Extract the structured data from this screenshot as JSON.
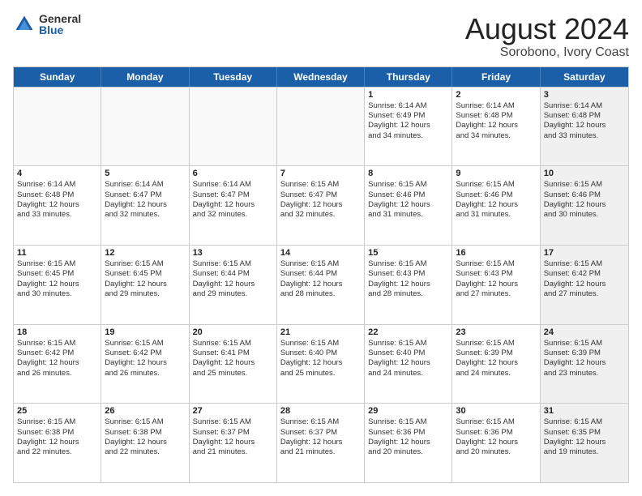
{
  "logo": {
    "general": "General",
    "blue": "Blue"
  },
  "title": "August 2024",
  "location": "Sorobono, Ivory Coast",
  "days": [
    "Sunday",
    "Monday",
    "Tuesday",
    "Wednesday",
    "Thursday",
    "Friday",
    "Saturday"
  ],
  "weeks": [
    [
      {
        "day": "",
        "empty": true
      },
      {
        "day": "",
        "empty": true
      },
      {
        "day": "",
        "empty": true
      },
      {
        "day": "",
        "empty": true
      },
      {
        "day": "1",
        "lines": [
          "Sunrise: 6:14 AM",
          "Sunset: 6:49 PM",
          "Daylight: 12 hours",
          "and 34 minutes."
        ]
      },
      {
        "day": "2",
        "lines": [
          "Sunrise: 6:14 AM",
          "Sunset: 6:48 PM",
          "Daylight: 12 hours",
          "and 34 minutes."
        ]
      },
      {
        "day": "3",
        "shaded": true,
        "lines": [
          "Sunrise: 6:14 AM",
          "Sunset: 6:48 PM",
          "Daylight: 12 hours",
          "and 33 minutes."
        ]
      }
    ],
    [
      {
        "day": "4",
        "lines": [
          "Sunrise: 6:14 AM",
          "Sunset: 6:48 PM",
          "Daylight: 12 hours",
          "and 33 minutes."
        ]
      },
      {
        "day": "5",
        "lines": [
          "Sunrise: 6:14 AM",
          "Sunset: 6:47 PM",
          "Daylight: 12 hours",
          "and 32 minutes."
        ]
      },
      {
        "day": "6",
        "lines": [
          "Sunrise: 6:14 AM",
          "Sunset: 6:47 PM",
          "Daylight: 12 hours",
          "and 32 minutes."
        ]
      },
      {
        "day": "7",
        "lines": [
          "Sunrise: 6:15 AM",
          "Sunset: 6:47 PM",
          "Daylight: 12 hours",
          "and 32 minutes."
        ]
      },
      {
        "day": "8",
        "lines": [
          "Sunrise: 6:15 AM",
          "Sunset: 6:46 PM",
          "Daylight: 12 hours",
          "and 31 minutes."
        ]
      },
      {
        "day": "9",
        "lines": [
          "Sunrise: 6:15 AM",
          "Sunset: 6:46 PM",
          "Daylight: 12 hours",
          "and 31 minutes."
        ]
      },
      {
        "day": "10",
        "shaded": true,
        "lines": [
          "Sunrise: 6:15 AM",
          "Sunset: 6:46 PM",
          "Daylight: 12 hours",
          "and 30 minutes."
        ]
      }
    ],
    [
      {
        "day": "11",
        "lines": [
          "Sunrise: 6:15 AM",
          "Sunset: 6:45 PM",
          "Daylight: 12 hours",
          "and 30 minutes."
        ]
      },
      {
        "day": "12",
        "lines": [
          "Sunrise: 6:15 AM",
          "Sunset: 6:45 PM",
          "Daylight: 12 hours",
          "and 29 minutes."
        ]
      },
      {
        "day": "13",
        "lines": [
          "Sunrise: 6:15 AM",
          "Sunset: 6:44 PM",
          "Daylight: 12 hours",
          "and 29 minutes."
        ]
      },
      {
        "day": "14",
        "lines": [
          "Sunrise: 6:15 AM",
          "Sunset: 6:44 PM",
          "Daylight: 12 hours",
          "and 28 minutes."
        ]
      },
      {
        "day": "15",
        "lines": [
          "Sunrise: 6:15 AM",
          "Sunset: 6:43 PM",
          "Daylight: 12 hours",
          "and 28 minutes."
        ]
      },
      {
        "day": "16",
        "lines": [
          "Sunrise: 6:15 AM",
          "Sunset: 6:43 PM",
          "Daylight: 12 hours",
          "and 27 minutes."
        ]
      },
      {
        "day": "17",
        "shaded": true,
        "lines": [
          "Sunrise: 6:15 AM",
          "Sunset: 6:42 PM",
          "Daylight: 12 hours",
          "and 27 minutes."
        ]
      }
    ],
    [
      {
        "day": "18",
        "lines": [
          "Sunrise: 6:15 AM",
          "Sunset: 6:42 PM",
          "Daylight: 12 hours",
          "and 26 minutes."
        ]
      },
      {
        "day": "19",
        "lines": [
          "Sunrise: 6:15 AM",
          "Sunset: 6:42 PM",
          "Daylight: 12 hours",
          "and 26 minutes."
        ]
      },
      {
        "day": "20",
        "lines": [
          "Sunrise: 6:15 AM",
          "Sunset: 6:41 PM",
          "Daylight: 12 hours",
          "and 25 minutes."
        ]
      },
      {
        "day": "21",
        "lines": [
          "Sunrise: 6:15 AM",
          "Sunset: 6:40 PM",
          "Daylight: 12 hours",
          "and 25 minutes."
        ]
      },
      {
        "day": "22",
        "lines": [
          "Sunrise: 6:15 AM",
          "Sunset: 6:40 PM",
          "Daylight: 12 hours",
          "and 24 minutes."
        ]
      },
      {
        "day": "23",
        "lines": [
          "Sunrise: 6:15 AM",
          "Sunset: 6:39 PM",
          "Daylight: 12 hours",
          "and 24 minutes."
        ]
      },
      {
        "day": "24",
        "shaded": true,
        "lines": [
          "Sunrise: 6:15 AM",
          "Sunset: 6:39 PM",
          "Daylight: 12 hours",
          "and 23 minutes."
        ]
      }
    ],
    [
      {
        "day": "25",
        "lines": [
          "Sunrise: 6:15 AM",
          "Sunset: 6:38 PM",
          "Daylight: 12 hours",
          "and 22 minutes."
        ]
      },
      {
        "day": "26",
        "lines": [
          "Sunrise: 6:15 AM",
          "Sunset: 6:38 PM",
          "Daylight: 12 hours",
          "and 22 minutes."
        ]
      },
      {
        "day": "27",
        "lines": [
          "Sunrise: 6:15 AM",
          "Sunset: 6:37 PM",
          "Daylight: 12 hours",
          "and 21 minutes."
        ]
      },
      {
        "day": "28",
        "lines": [
          "Sunrise: 6:15 AM",
          "Sunset: 6:37 PM",
          "Daylight: 12 hours",
          "and 21 minutes."
        ]
      },
      {
        "day": "29",
        "lines": [
          "Sunrise: 6:15 AM",
          "Sunset: 6:36 PM",
          "Daylight: 12 hours",
          "and 20 minutes."
        ]
      },
      {
        "day": "30",
        "lines": [
          "Sunrise: 6:15 AM",
          "Sunset: 6:36 PM",
          "Daylight: 12 hours",
          "and 20 minutes."
        ]
      },
      {
        "day": "31",
        "shaded": true,
        "lines": [
          "Sunrise: 6:15 AM",
          "Sunset: 6:35 PM",
          "Daylight: 12 hours",
          "and 19 minutes."
        ]
      }
    ]
  ]
}
